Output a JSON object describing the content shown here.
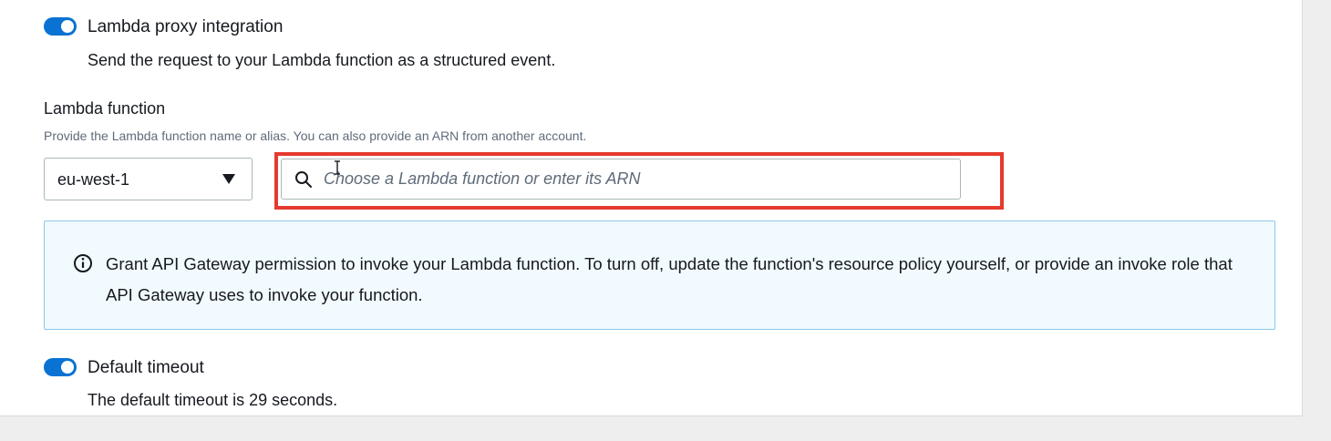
{
  "proxy_integration": {
    "label": "Lambda proxy integration",
    "description": "Send the request to your Lambda function as a structured event.",
    "enabled": true
  },
  "lambda_function": {
    "label": "Lambda function",
    "description": "Provide the Lambda function name or alias. You can also provide an ARN from another account.",
    "region_value": "eu-west-1",
    "search_placeholder": "Choose a Lambda function or enter its ARN",
    "search_value": ""
  },
  "info_alert": {
    "text": "Grant API Gateway permission to invoke your Lambda function. To turn off, update the function's resource policy yourself, or provide an invoke role that API Gateway uses to invoke your function."
  },
  "default_timeout": {
    "label": "Default timeout",
    "description": "The default timeout is 29 seconds.",
    "enabled": true
  },
  "colors": {
    "toggle_on": "#0972d3",
    "highlight": "#e53a2d",
    "info_background": "#f1faff",
    "info_border": "#8ec9e6"
  },
  "icons": {
    "search": "search-icon",
    "info": "info-icon",
    "dropdown": "caret-down-icon",
    "cursor": "text-cursor-icon"
  }
}
